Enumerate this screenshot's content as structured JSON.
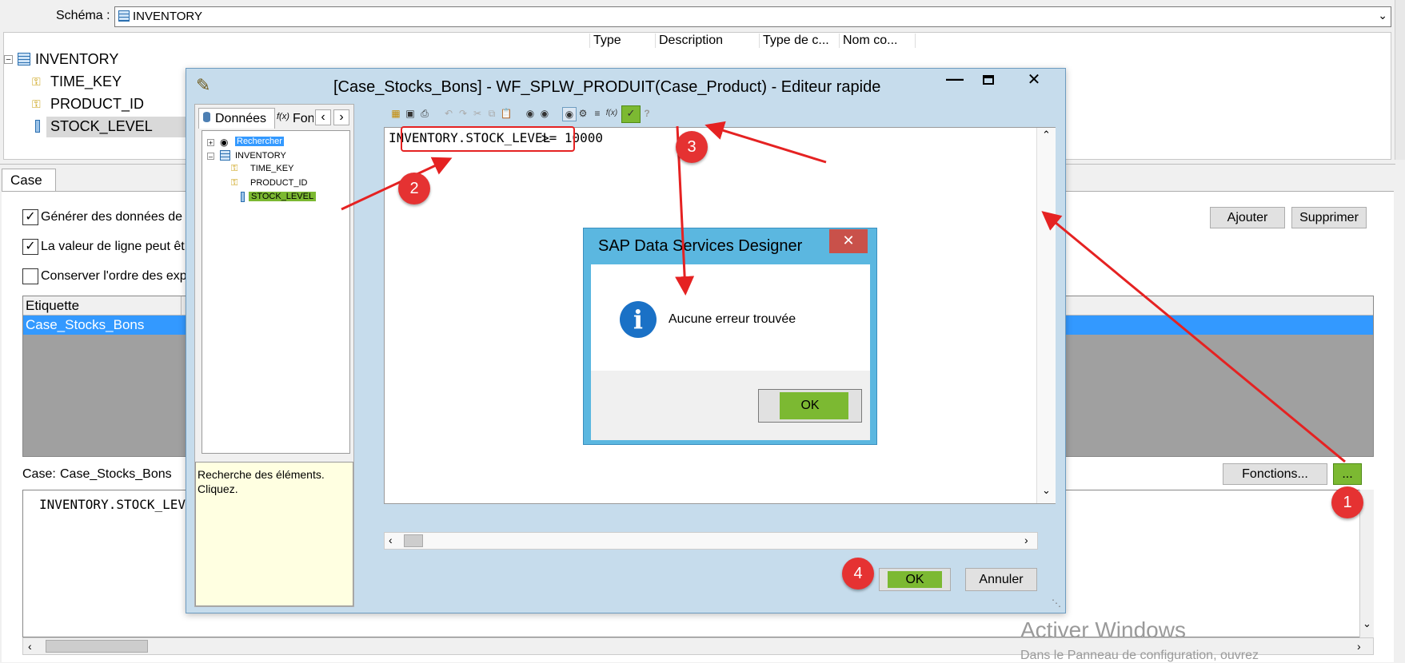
{
  "schema": {
    "label": "Schéma :",
    "value": "INVENTORY",
    "columns": [
      "Type",
      "Description",
      "Type de c...",
      "Nom co..."
    ],
    "tree": {
      "root": "INVENTORY",
      "items": [
        "TIME_KEY",
        "PRODUCT_ID",
        "STOCK_LEVEL"
      ]
    }
  },
  "case_tab": {
    "tab_label": "Case",
    "checkboxes": [
      {
        "label": "Générer des données de s",
        "checked": true
      },
      {
        "label": "La valeur de ligne peut êt",
        "checked": true
      },
      {
        "label": "Conserver l'ordre des exp",
        "checked": false
      }
    ],
    "add_button": "Ajouter",
    "delete_button": "Supprimer",
    "table_header": "Etiquette",
    "table_rows": [
      "Case_Stocks_Bons"
    ],
    "case_label": "Case:",
    "case_name": "Case_Stocks_Bons",
    "functions_button": "Fonctions...",
    "ellipsis_button": "...",
    "expression_preview": "INVENTORY.STOCK_LEV"
  },
  "editor": {
    "title": "[Case_Stocks_Bons] - WF_SPLW_PRODUIT(Case_Product) - Editeur rapide",
    "tabs": [
      "Données",
      "Fonc"
    ],
    "tree": {
      "search": "Rechercher",
      "root": "INVENTORY",
      "items": [
        "TIME_KEY",
        "PRODUCT_ID",
        "STOCK_LEVEL"
      ]
    },
    "hint": "Recherche des éléments. Cliquez.",
    "expression_field": "INVENTORY.STOCK_LEVEL",
    "expression_rest": ">= 10000",
    "ok_button": "OK",
    "cancel_button": "Annuler"
  },
  "dialog": {
    "title": "SAP Data Services Designer",
    "message": "Aucune erreur trouvée",
    "ok_button": "OK",
    "info_glyph": "i"
  },
  "annotations": [
    "1",
    "2",
    "3",
    "4"
  ],
  "watermark": {
    "title": "Activer Windows",
    "subtitle": "Dans le Panneau de configuration, ouvrez"
  },
  "colors": {
    "accent_green": "#7cb932",
    "selection_blue": "#3399ff",
    "annotation_red": "#e52222",
    "dialog_border": "#5bb7e0"
  }
}
